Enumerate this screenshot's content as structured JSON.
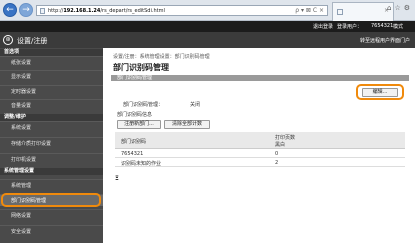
{
  "browser": {
    "nav_back": "←",
    "nav_forward": "→",
    "url_prefix": "http://",
    "url_host": "192.168.1.24",
    "url_path": "/rs_depart/rs_editSdi.html",
    "address_icons": "ρ ▾ ⊠ C ×",
    "tab_close": "×",
    "right_icons": "⌂☆⚙"
  },
  "topbar": {
    "logout": "退出登录",
    "user_label": "登录用户：",
    "user_id": "7654321",
    "mode_label": "模式"
  },
  "header": {
    "logo": "⊛",
    "title": "设置/注册",
    "portal_link": "转至远程用户界面门户"
  },
  "sidebar": {
    "sections": [
      {
        "heading": "首选项",
        "items": [
          "纸张设置",
          "显示设置",
          "定时器设置",
          "音量设置"
        ]
      },
      {
        "heading": "调整/维护",
        "items": [
          "系统设置",
          "存储介质打印设置",
          "打印机设置"
        ]
      },
      {
        "heading": "系统管理设置",
        "items": [
          "系统管理",
          "部门识别码管理",
          "网络设置",
          "安全设置"
        ]
      }
    ],
    "selected_item": "部门识别码管理"
  },
  "main": {
    "breadcrumb": "设置/注册：系统管理设置：部门识别码管理",
    "title": "部门识别码管理",
    "section_title": "部门识别码管理",
    "edit_button": "编辑...",
    "setting_label": "部门识别码管理：",
    "setting_value": "关闭",
    "subsection_title": "部门识别码信息",
    "register_button": "注册新部门...",
    "clear_button": "清除全部计数",
    "table": {
      "col1_header": "部门识别码",
      "col2_header_line1": "打印页数",
      "col2_header_line2": "黑白",
      "rows": [
        {
          "id": "7654321",
          "count": "0"
        },
        {
          "id": "识别码未知的作业",
          "count": "2"
        }
      ]
    },
    "total_mark": "Ξ"
  }
}
